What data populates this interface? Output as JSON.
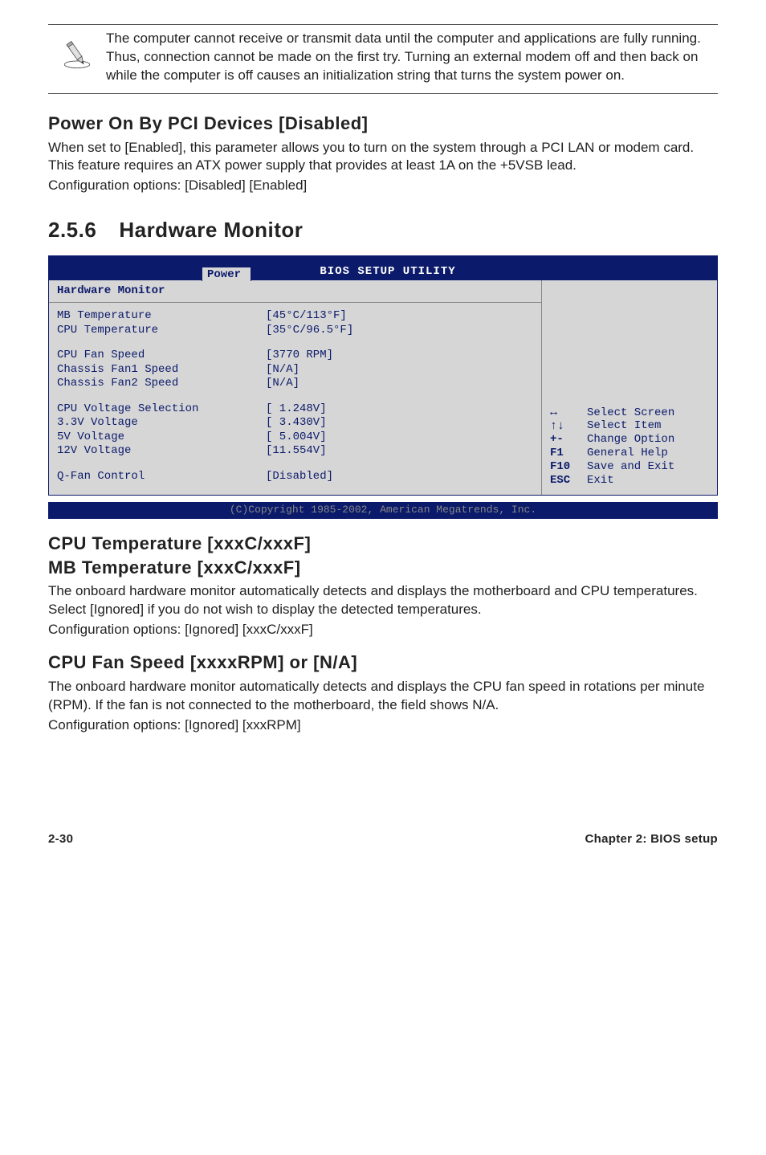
{
  "note": {
    "text": "The computer cannot receive or transmit data until the computer and applications are fully running. Thus, connection cannot be made on the first try. Turning an external modem off and then back on while the computer is off causes an initialization string that turns the system power on.",
    "icon_name": "pencil-note-icon"
  },
  "power_on": {
    "heading": "Power On By PCI Devices [Disabled]",
    "body1": "When set to [Enabled], this parameter allows you to turn on the system through a PCI LAN or modem card. This feature requires an ATX power supply that provides at least 1A on the +5VSB lead.",
    "body2": "Configuration options: [Disabled] [Enabled]"
  },
  "hw_section": {
    "number": "2.5.6",
    "title": "Hardware Monitor"
  },
  "bios": {
    "title": "BIOS SETUP UTILITY",
    "tab": "Power",
    "panel_title": "Hardware Monitor",
    "rows": [
      {
        "label": "MB Temperature",
        "value": "[45°C/113°F]"
      },
      {
        "label": "CPU Temperature",
        "value": "[35°C/96.5°F]"
      }
    ],
    "rows2": [
      {
        "label": "CPU Fan Speed",
        "value": "[3770 RPM]"
      },
      {
        "label": "Chassis Fan1 Speed",
        "value": "[N/A]"
      },
      {
        "label": "Chassis Fan2 Speed",
        "value": "[N/A]"
      }
    ],
    "rows3": [
      {
        "label": "CPU Voltage Selection",
        "value": "[ 1.248V]"
      },
      {
        "label": "3.3V Voltage",
        "value": "[ 3.430V]"
      },
      {
        "label": "5V Voltage",
        "value": "[ 5.004V]"
      },
      {
        "label": "12V Voltage",
        "value": "[11.554V]"
      }
    ],
    "rows4": [
      {
        "label": "Q-Fan Control",
        "value": "[Disabled]"
      }
    ],
    "help": [
      {
        "keyglyph": "↔",
        "text": "Select Screen"
      },
      {
        "keyglyph": "↑↓",
        "text": "Select Item"
      },
      {
        "keyglyph": "+-",
        "text": "Change Option"
      },
      {
        "keyglyph": "F1",
        "text": "General Help"
      },
      {
        "keyglyph": "F10",
        "text": "Save and Exit"
      },
      {
        "keyglyph": "ESC",
        "text": "Exit"
      }
    ],
    "copyright": "(C)Copyright 1985-2002, American Megatrends, Inc."
  },
  "cpu_temp": {
    "heading1": "CPU Temperature [xxxC/xxxF]",
    "heading2": "MB Temperature [xxxC/xxxF]",
    "body1": "The onboard hardware monitor automatically detects and displays the motherboard and CPU temperatures. Select [Ignored] if you do not wish to display the detected temperatures.",
    "body2": "Configuration options: [Ignored] [xxxC/xxxF]"
  },
  "cpu_fan": {
    "heading": "CPU Fan Speed [xxxxRPM] or [N/A]",
    "body1": "The onboard hardware monitor automatically detects and displays the CPU fan speed in rotations per minute (RPM). If the fan is not connected to the motherboard, the field shows N/A.",
    "body2": "Configuration options: [Ignored] [xxxRPM]"
  },
  "footer": {
    "left": "2-30",
    "right": "Chapter 2: BIOS setup"
  }
}
